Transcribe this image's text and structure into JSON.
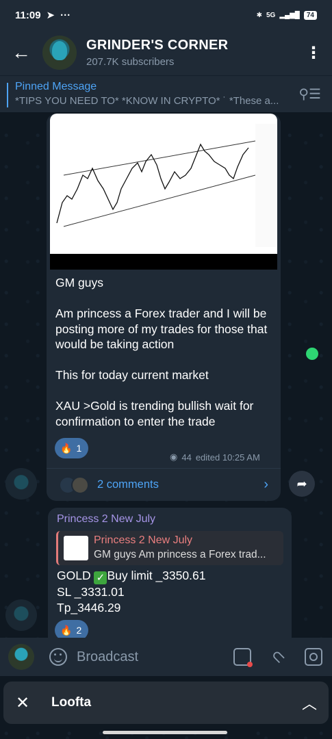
{
  "status_bar": {
    "time": "11:09",
    "left_icons": [
      "telegram-icon",
      "more-icon"
    ],
    "network": "5G",
    "battery": "74"
  },
  "header": {
    "title": "GRINDER'S CORNER",
    "subtitle": "207.7K subscribers"
  },
  "pinned": {
    "label": "Pinned Message",
    "text": "*TIPS YOU NEED TO* *KNOW IN CRYPTO* ˙  *These a..."
  },
  "post1": {
    "lines": [
      "GM guys",
      "",
      "Am princess a Forex trader and I will be posting  more of my trades  for those that would be taking action",
      "",
      "This for today current market",
      "",
      "XAU >Gold is trending bullish wait for confirmation to enter the trade"
    ],
    "reaction": {
      "emoji": "🔥",
      "count": "1"
    },
    "views": "44",
    "edited": "edited 10:25 AM",
    "comments": "2 comments"
  },
  "post2": {
    "author": "Princess 2 New July",
    "reply_author": "Princess 2 New July",
    "reply_text": "GM guys  Am princess a Forex trad...",
    "line1_prefix": "GOLD ",
    "line1_suffix": "Buy limit _3350.61",
    "line2": "SL _3331.01",
    "line3": "Tp_3446.29",
    "reaction": {
      "emoji": "🔥",
      "count": "2"
    }
  },
  "input": {
    "placeholder": "Broadcast"
  },
  "mini_app": {
    "name": "Loofta"
  },
  "colors": {
    "accent": "#4ea4f6",
    "reaction_bg": "#3f6ea3",
    "author2": "#a695e7",
    "reply_author": "#ea7f7f",
    "online": "#2ed573"
  }
}
